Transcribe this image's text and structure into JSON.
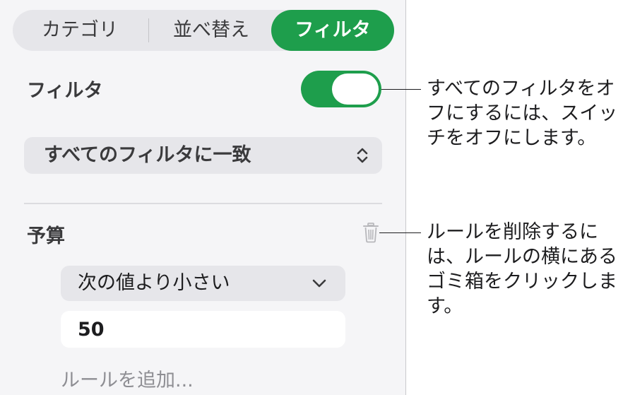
{
  "segmented": {
    "category_label": "カテゴリ",
    "sort_label": "並べ替え",
    "filter_label": "フィルタ",
    "selected": "フィルタ"
  },
  "filter_section": {
    "label": "フィルタ",
    "toggle_on": true
  },
  "match_select": {
    "value": "すべてのフィルタに一致"
  },
  "rule": {
    "column_name": "予算",
    "condition": "次の値より小さい",
    "value": "50"
  },
  "add_rule_label": "ルールを追加...",
  "callouts": {
    "toggle_note": "すべてのフィルタをオフにするには、スイッチをオフにします。",
    "delete_note": "ルールを削除するには、ルールの横にあるゴミ箱をクリックします。"
  },
  "colors": {
    "accent": "#1e9e4c",
    "panel_bg": "#f5f5f7",
    "control_bg": "#e6e6ea"
  },
  "icons": {
    "updown": "chevron-up-down-icon",
    "trash": "trash-icon",
    "dropdown": "chevron-down-icon"
  }
}
